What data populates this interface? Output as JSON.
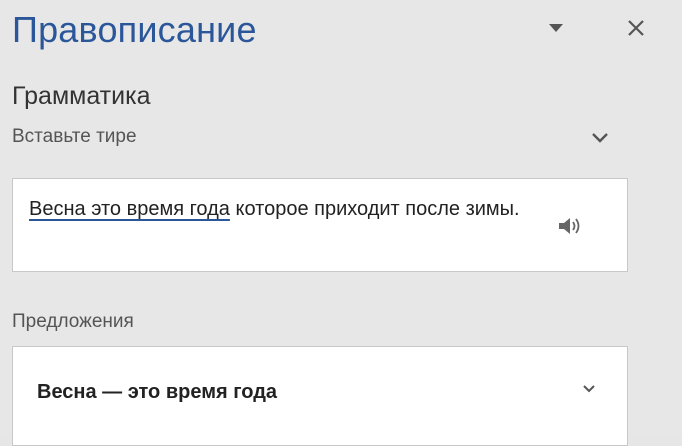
{
  "pane": {
    "title": "Правописание"
  },
  "section": {
    "title": "Грамматика"
  },
  "issue": {
    "label": "Вставьте тире"
  },
  "context": {
    "flagged_text": "Весна это время года",
    "rest_text": " которое приходит после зимы."
  },
  "suggestions": {
    "label": "Предложения",
    "items": [
      {
        "text": "Весна — это время года"
      }
    ]
  },
  "colors": {
    "accent": "#2b579a",
    "background": "#e7e7e7",
    "box": "#ffffff"
  },
  "icons": {
    "menu": "caret-down-icon",
    "close": "close-icon",
    "expand": "chevron-down-icon",
    "speaker": "speaker-icon"
  }
}
